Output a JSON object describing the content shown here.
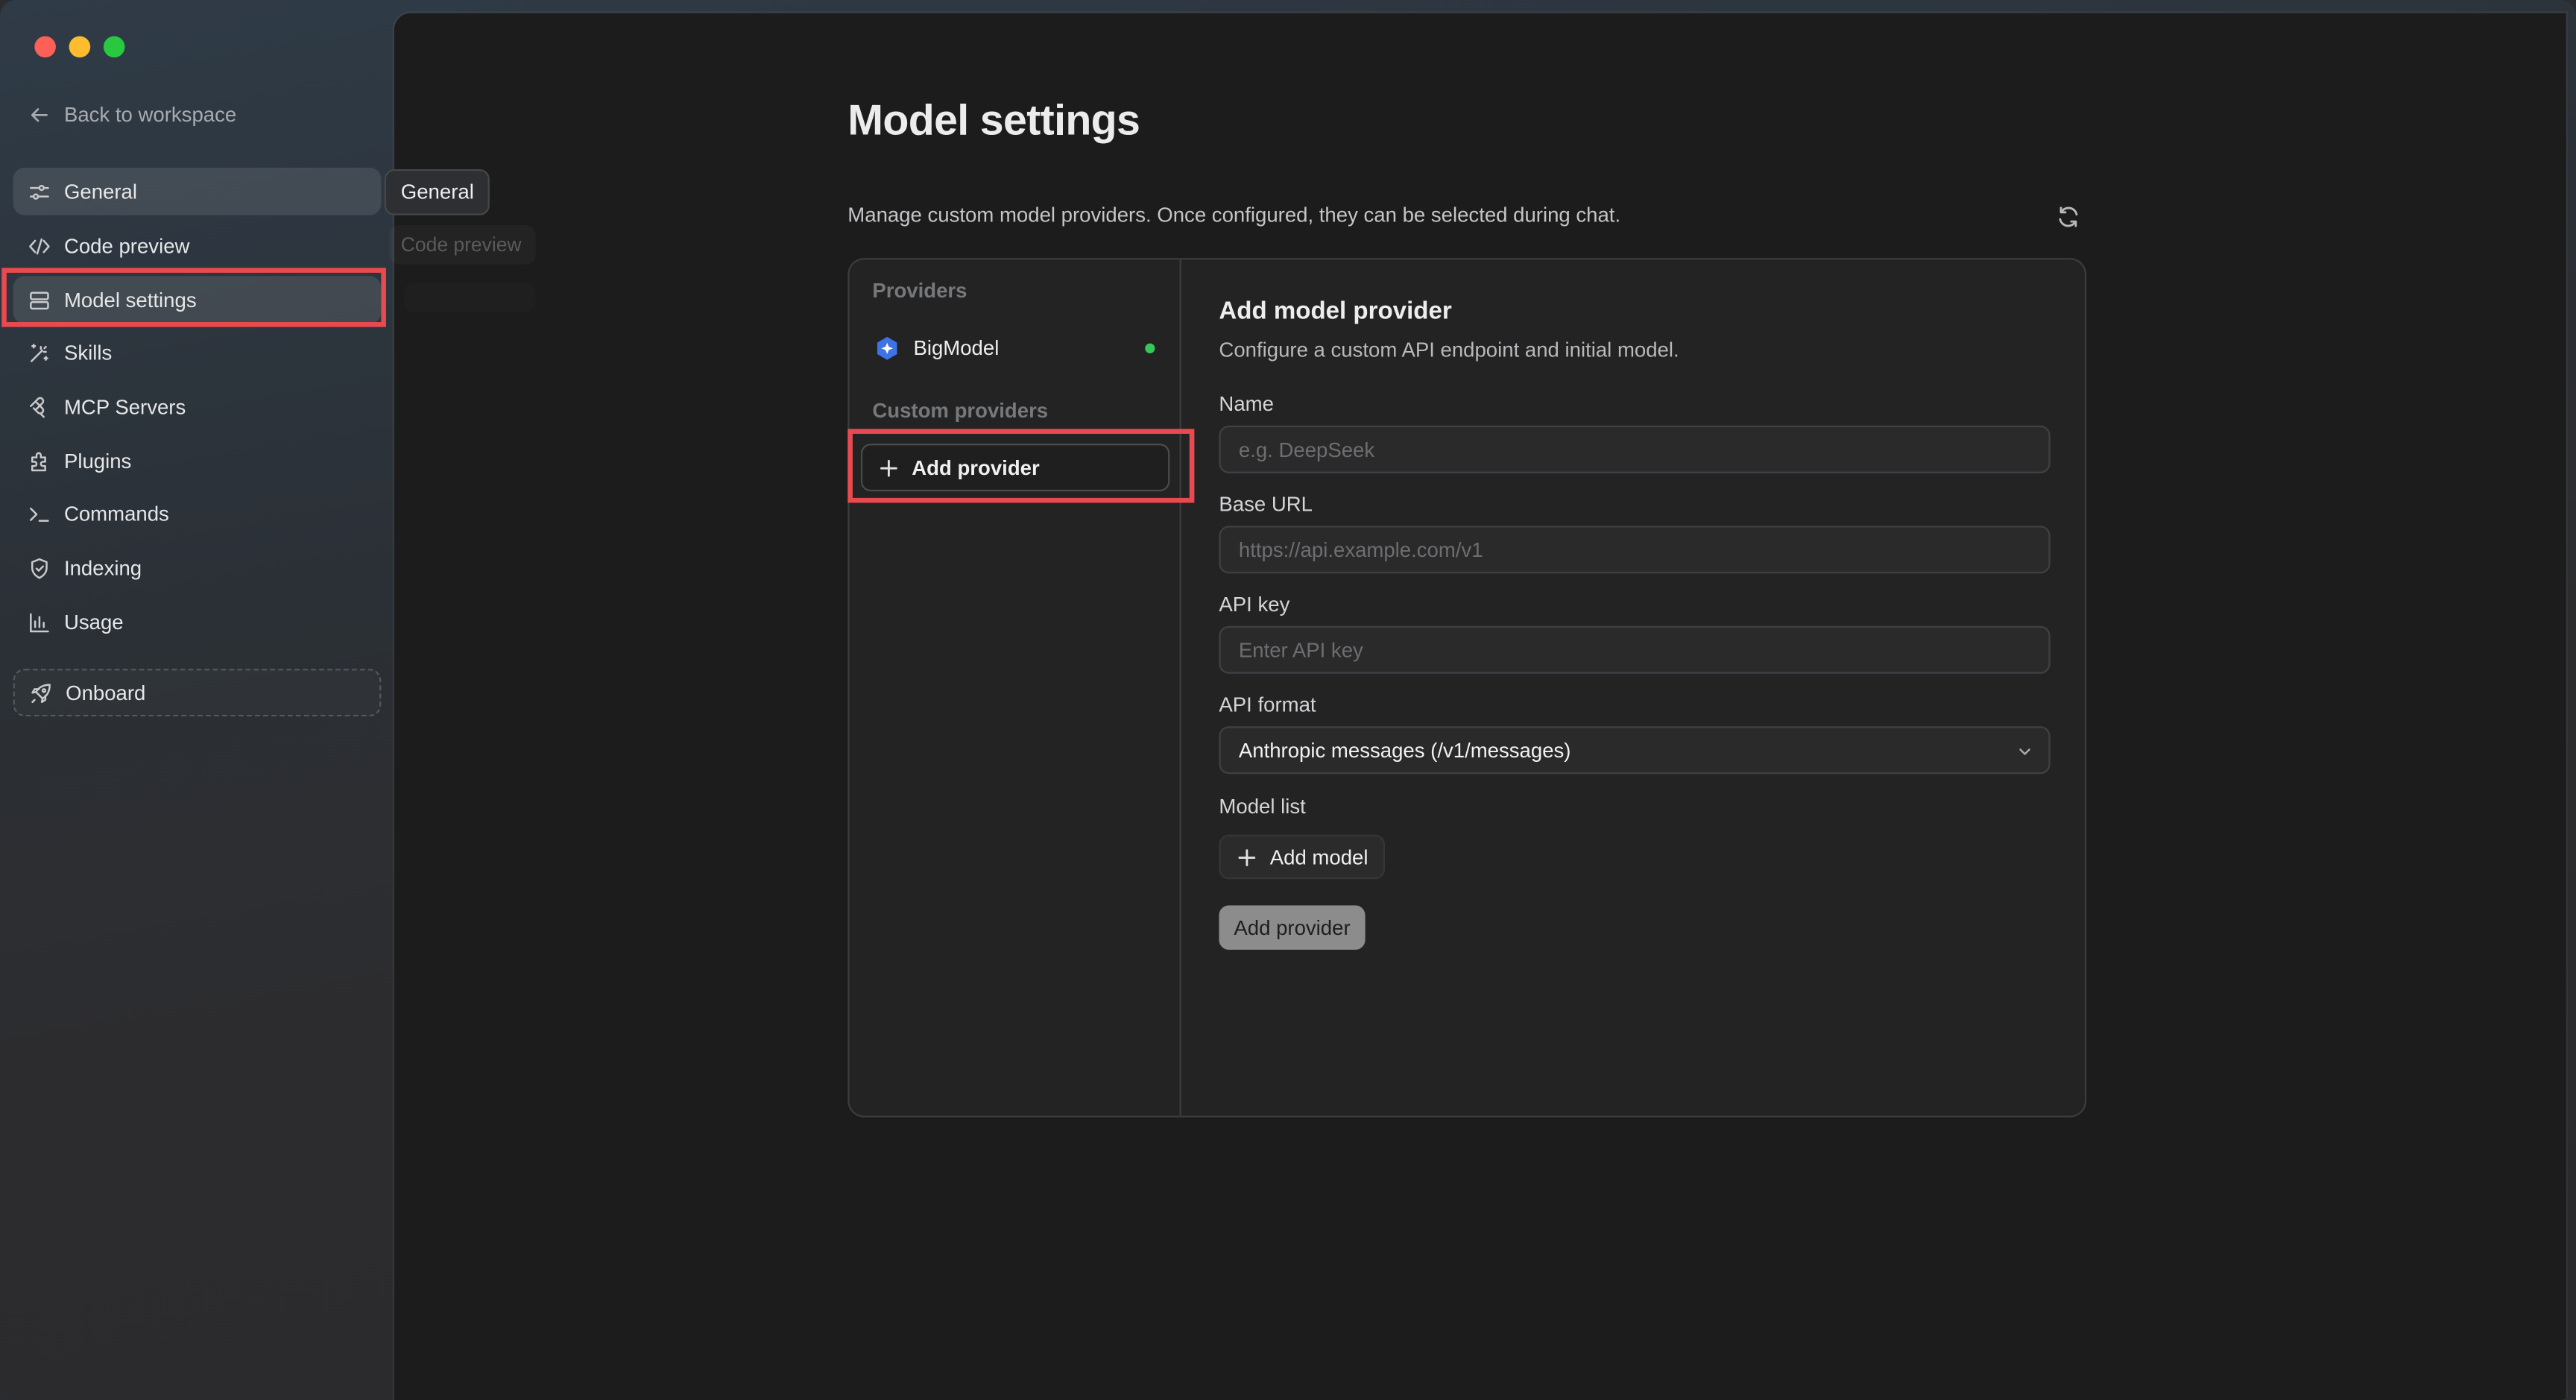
{
  "window": {
    "controls": [
      "close",
      "minimize",
      "zoom"
    ]
  },
  "sidebar": {
    "back_label": "Back to workspace",
    "items": [
      {
        "label": "General",
        "icon": "sliders-icon"
      },
      {
        "label": "Code preview",
        "icon": "code-icon"
      },
      {
        "label": "Model settings",
        "icon": "server-icon"
      },
      {
        "label": "Skills",
        "icon": "magic-wand-icon"
      },
      {
        "label": "MCP Servers",
        "icon": "mcp-icon"
      },
      {
        "label": "Plugins",
        "icon": "puzzle-icon"
      },
      {
        "label": "Commands",
        "icon": "terminal-icon"
      },
      {
        "label": "Indexing",
        "icon": "shield-icon"
      },
      {
        "label": "Usage",
        "icon": "bar-chart-icon"
      }
    ],
    "onboard_label": "Onboard"
  },
  "tooltip": {
    "text": "General",
    "ghost_text": "Code preview"
  },
  "main": {
    "title": "Model settings",
    "description": "Manage custom model providers. Once configured, they can be selected during chat."
  },
  "providers": {
    "section_label": "Providers",
    "items": [
      {
        "name": "BigModel",
        "status_color": "#34c759"
      }
    ],
    "custom_label": "Custom providers",
    "add_button_label": "Add provider"
  },
  "form": {
    "title": "Add model provider",
    "subtitle": "Configure a custom API endpoint and initial model.",
    "name_label": "Name",
    "name_placeholder": "e.g. DeepSeek",
    "base_url_label": "Base URL",
    "base_url_placeholder": "https://api.example.com/v1",
    "api_key_label": "API key",
    "api_key_placeholder": "Enter API key",
    "api_format_label": "API format",
    "api_format_value": "Anthropic messages (/v1/messages)",
    "model_list_label": "Model list",
    "add_model_label": "Add model",
    "submit_label": "Add provider"
  },
  "colors": {
    "highlight": "#e84a4f",
    "status_online": "#34c759",
    "close": "#fe5f57",
    "minimize": "#febc2e",
    "zoom": "#28c840"
  }
}
